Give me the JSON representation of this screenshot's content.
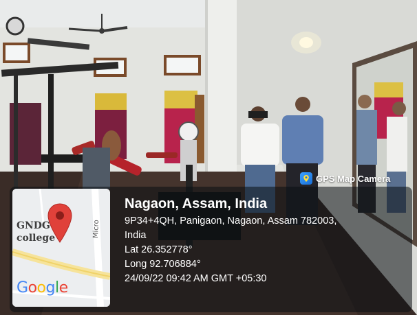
{
  "badge": {
    "label": "GPS Map Camera",
    "icon": "map-pin-camera-icon"
  },
  "map": {
    "place_label_line1": "GNDG",
    "place_label_line2": "college",
    "road_label": "Micro",
    "logo_text": "Google",
    "pin_icon": "map-pin-icon",
    "pin_color": "#e0413a"
  },
  "location": {
    "title": "Nagaon, Assam, India",
    "address_line1": "9P34+4QH, Panigaon, Nagaon, Assam 782003,",
    "address_line2": "India",
    "latitude": "Lat 26.352778°",
    "longitude": "Long 92.706884°",
    "timestamp": "24/09/22 09:42 AM GMT +05:30"
  },
  "scene": {
    "description_icon": "gym-photo"
  }
}
